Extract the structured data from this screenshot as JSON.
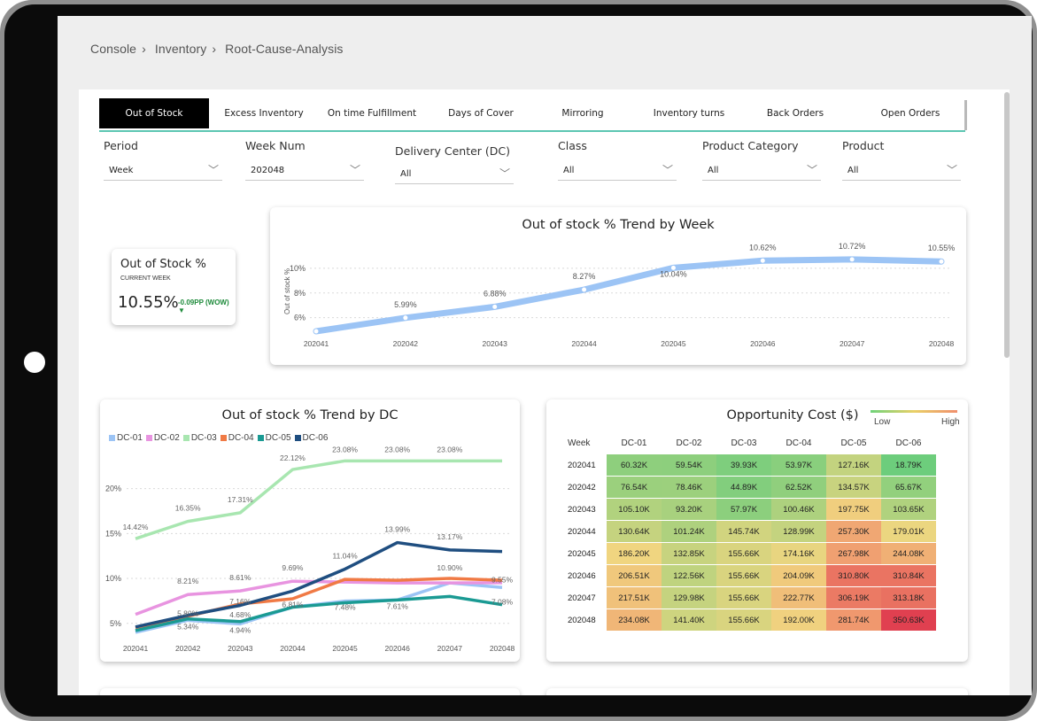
{
  "breadcrumb": [
    "Console",
    "Inventory",
    "Root-Cause-Analysis"
  ],
  "breadcrumb_sep": "›",
  "tabs": [
    {
      "label": "Out of Stock",
      "active": true
    },
    {
      "label": "Excess Inventory",
      "active": false
    },
    {
      "label": "On time Fulfillment",
      "active": false
    },
    {
      "label": "Days of Cover",
      "active": false
    },
    {
      "label": "Mirroring",
      "active": false
    },
    {
      "label": "Inventory turns",
      "active": false
    },
    {
      "label": "Back Orders",
      "active": false
    },
    {
      "label": "Open Orders",
      "active": false
    }
  ],
  "filters": {
    "period": {
      "label": "Period",
      "value": "Week"
    },
    "week_num": {
      "label": "Week Num",
      "value": "202048"
    },
    "dc": {
      "label": "Delivery Center (DC)",
      "value": "All"
    },
    "class": {
      "label": "Class",
      "value": "All"
    },
    "product_category": {
      "label": "Product Category",
      "value": "All"
    },
    "product": {
      "label": "Product",
      "value": "All"
    }
  },
  "kpi": {
    "title": "Out of Stock %",
    "subtitle": "CURRENT WEEK",
    "value": "10.55%",
    "delta": "-0.09PP (WOW) ▼",
    "delta_color": "#1d8a3a"
  },
  "chart_data": [
    {
      "type": "line",
      "title": "Out of stock % Trend by Week",
      "ylabel": "Out of stock %",
      "x": [
        "202041",
        "202042",
        "202043",
        "202044",
        "202045",
        "202046",
        "202047",
        "202048"
      ],
      "y_ticks": [
        "6%",
        "8%",
        "10%"
      ],
      "ylim": [
        4.9,
        11.5
      ],
      "series": [
        {
          "values": [
            4.9,
            5.99,
            6.88,
            8.27,
            10.04,
            10.62,
            10.72,
            10.55
          ],
          "labels": [
            "",
            "5.99%",
            "6.88%",
            "8.27%",
            "10.04%",
            "10.62%",
            "10.72%",
            "10.55%"
          ],
          "color": "#9cc4f5"
        }
      ]
    },
    {
      "type": "line",
      "title": "Out of stock % Trend by DC",
      "x": [
        "202041",
        "202042",
        "202043",
        "202044",
        "202045",
        "202046",
        "202047",
        "202048"
      ],
      "y_ticks": [
        "5%",
        "10%",
        "15%",
        "20%"
      ],
      "ylim": [
        3.5,
        24
      ],
      "legend_position": "top-left",
      "series": [
        {
          "name": "DC-01",
          "color": "#9cc4f5",
          "values": [
            4.0,
            5.34,
            4.94,
            6.81,
            7.48,
            7.61,
            9.5,
            9.0
          ]
        },
        {
          "name": "DC-02",
          "color": "#e894e0",
          "values": [
            6.0,
            8.21,
            8.61,
            9.69,
            9.6,
            9.5,
            9.5,
            9.52
          ]
        },
        {
          "name": "DC-03",
          "color": "#a8e6b0",
          "values": [
            14.42,
            16.35,
            17.31,
            22.12,
            23.08,
            23.08,
            23.08,
            23.08
          ]
        },
        {
          "name": "DC-04",
          "color": "#f07a45",
          "values": [
            4.5,
            5.8,
            7.16,
            7.74,
            9.9,
            9.8,
            10.0,
            9.8
          ]
        },
        {
          "name": "DC-05",
          "color": "#1a9a93",
          "values": [
            4.2,
            5.5,
            5.2,
            6.8,
            7.3,
            7.6,
            8.0,
            7.08
          ]
        },
        {
          "name": "DC-06",
          "color": "#1f4e80",
          "values": [
            4.6,
            5.9,
            7.0,
            8.6,
            11.04,
            13.99,
            13.17,
            13.0
          ]
        }
      ],
      "point_labels": [
        "14.42%",
        "16.35%",
        "17.31%",
        "22.12%",
        "23.08%",
        "23.08%",
        "23.08%",
        "8.21%",
        "8.61%",
        "9.69%",
        "11.04%",
        "13.99%",
        "13.17%",
        "5.80%",
        "7.16%",
        "10.90%",
        "9.55%",
        "7.08%",
        "4.68%",
        "6.81%",
        "7.48%",
        "7.61%",
        "5.34%",
        "4.94%"
      ]
    },
    {
      "type": "heatmap",
      "title": "Opportunity Cost ($)",
      "legend_low": "Low",
      "legend_high": "High",
      "row_header": "Week",
      "columns": [
        "DC-01",
        "DC-02",
        "DC-03",
        "DC-04",
        "DC-05",
        "DC-06"
      ],
      "rows": [
        {
          "week": "202041",
          "values": [
            "60.32K",
            "59.54K",
            "39.93K",
            "53.97K",
            "127.16K",
            "18.79K"
          ]
        },
        {
          "week": "202042",
          "values": [
            "76.54K",
            "78.46K",
            "44.89K",
            "62.52K",
            "134.57K",
            "65.67K"
          ]
        },
        {
          "week": "202043",
          "values": [
            "105.10K",
            "93.20K",
            "57.97K",
            "100.46K",
            "197.75K",
            "103.65K"
          ]
        },
        {
          "week": "202044",
          "values": [
            "130.64K",
            "101.24K",
            "145.74K",
            "128.99K",
            "257.30K",
            "179.01K"
          ]
        },
        {
          "week": "202045",
          "values": [
            "186.20K",
            "132.85K",
            "155.66K",
            "174.16K",
            "267.98K",
            "244.08K"
          ]
        },
        {
          "week": "202046",
          "values": [
            "206.51K",
            "122.56K",
            "155.66K",
            "204.09K",
            "310.80K",
            "310.84K"
          ]
        },
        {
          "week": "202047",
          "values": [
            "217.51K",
            "129.98K",
            "155.66K",
            "222.77K",
            "306.19K",
            "313.18K"
          ]
        },
        {
          "week": "202048",
          "values": [
            "234.08K",
            "141.40K",
            "155.66K",
            "192.00K",
            "281.74K",
            "350.63K"
          ]
        }
      ],
      "numeric": [
        [
          60.32,
          59.54,
          39.93,
          53.97,
          127.16,
          18.79
        ],
        [
          76.54,
          78.46,
          44.89,
          62.52,
          134.57,
          65.67
        ],
        [
          105.1,
          93.2,
          57.97,
          100.46,
          197.75,
          103.65
        ],
        [
          130.64,
          101.24,
          145.74,
          128.99,
          257.3,
          179.01
        ],
        [
          186.2,
          132.85,
          155.66,
          174.16,
          267.98,
          244.08
        ],
        [
          206.51,
          122.56,
          155.66,
          204.09,
          310.8,
          310.84
        ],
        [
          217.51,
          129.98,
          155.66,
          222.77,
          306.19,
          313.18
        ],
        [
          234.08,
          141.4,
          155.66,
          192.0,
          281.74,
          350.63
        ]
      ]
    }
  ]
}
